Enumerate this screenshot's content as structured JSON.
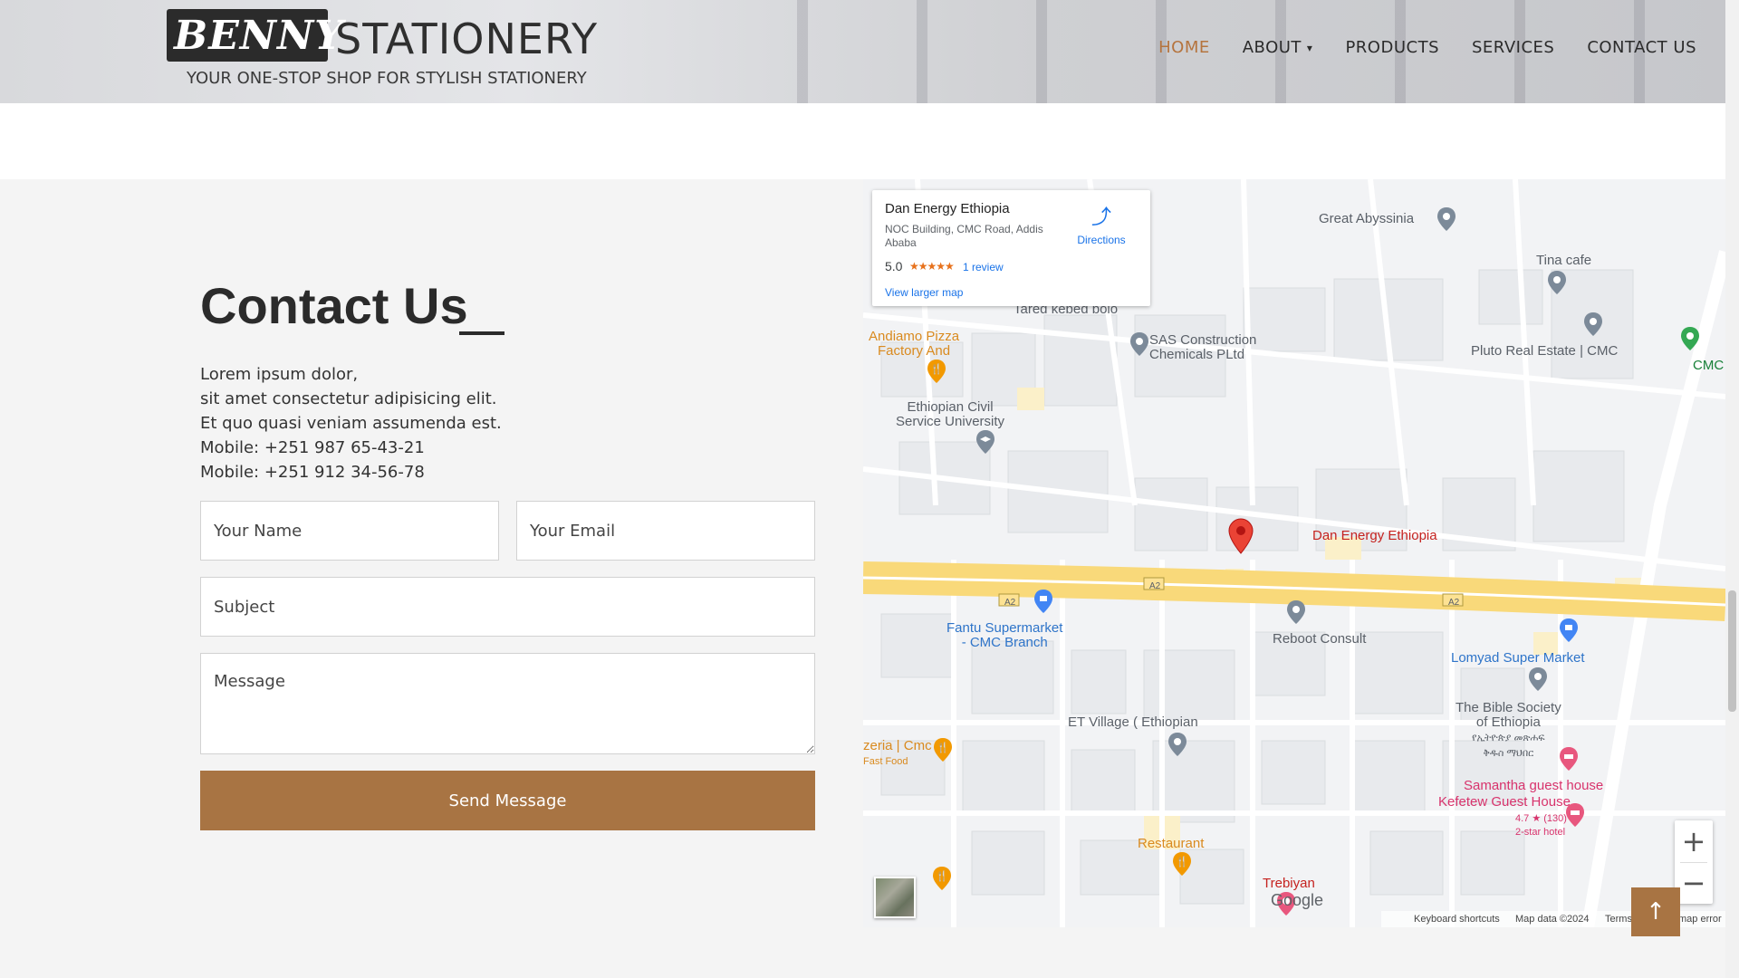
{
  "header": {
    "logo_box_text": "BENNY",
    "logo_main_text": "STATIONERY",
    "logo_tagline": "YOUR ONE-STOP SHOP FOR STYLISH STATIONERY",
    "nav": [
      {
        "label": "HOME",
        "active": true
      },
      {
        "label": "ABOUT",
        "has_dropdown": true
      },
      {
        "label": "PRODUCTS"
      },
      {
        "label": "SERVICES"
      },
      {
        "label": "CONTACT US"
      }
    ]
  },
  "contact": {
    "title": "Contact Us",
    "lines": [
      "Lorem ipsum dolor,",
      "sit amet consectetur adipisicing elit.",
      "Et quo quasi veniam assumenda est.",
      "Mobile: +251 987 65-43-21",
      "Mobile: +251 912 34-56-78"
    ],
    "form": {
      "name_placeholder": "Your Name",
      "email_placeholder": "Your Email",
      "subject_placeholder": "Subject",
      "message_placeholder": "Message",
      "send_label": "Send Message"
    }
  },
  "map": {
    "card": {
      "title": "Dan Energy Ethiopia",
      "address": "NOC Building, CMC Road, Addis Ababa",
      "rating": "5.0",
      "stars": "★★★★★",
      "reviews": "1 review",
      "larger_map": "View larger map",
      "directions": "Directions"
    },
    "labels": {
      "great_abyssinia": "Great Abyssinia",
      "tina_cafe": "Tina cafe",
      "pluto": "Pluto Real Estate | CMC",
      "cmc": "CMC",
      "tared": "Tared kebed bolo",
      "andiamo_1": "Andiamo Pizza",
      "andiamo_2": "Factory And",
      "sas_1": "SAS Construction",
      "sas_2": "Chemicals PLtd",
      "ecsu_1": "Ethiopian Civil",
      "ecsu_2": "Service University",
      "dan_energy": "Dan Energy Ethiopia",
      "road_a2": "A2",
      "fantu_1": "Fantu Supermarket",
      "fantu_2": "- CMC Branch",
      "reboot": "Reboot Consult",
      "lomyad": "Lomyad Super Market",
      "bible_1": "The Bible Society",
      "bible_2": "of Ethiopia",
      "bible_3": "የኢትዮጵያ መጽሐፍ",
      "bible_4": "ቅዱስ ማህበር",
      "et_village": "ET Village ( Ethiopian",
      "pizzeria": "zeria | Cmc",
      "fast_food": "Fast Food",
      "samantha": "Samantha guest house",
      "kefetew": "Kefetew Guest House",
      "kefetew_rating": "4.7 ★ (130)",
      "kefetew_class": "2-star hotel",
      "restaurant": "Restaurant",
      "trebiyan": "Trebiyan",
      "google": "Google"
    },
    "attribution": {
      "keyboard": "Keyboard shortcuts",
      "map_data": "Map data ©2024",
      "terms": "Terms",
      "report": "map error"
    },
    "zoom_in": "+",
    "zoom_out": "−"
  },
  "scroll_top_label": "↑",
  "colors": {
    "accent": "#a87443",
    "nav_active": "#b5743e",
    "road_yellow": "#f9d97a",
    "pin_red": "#ea4335"
  }
}
